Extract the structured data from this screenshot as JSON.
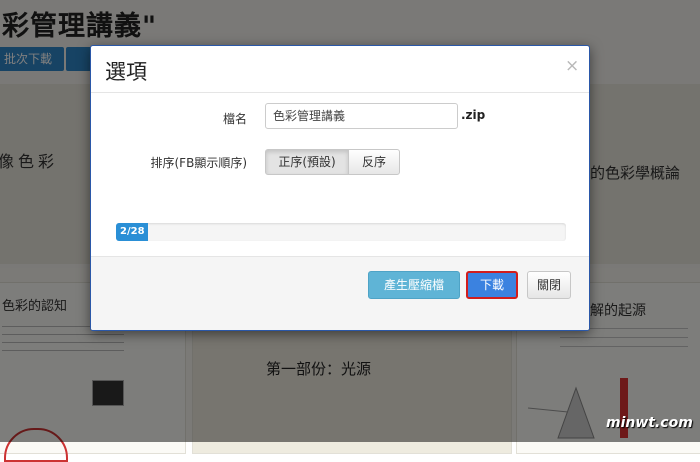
{
  "background": {
    "title": "彩管理講義\"",
    "buttons": [
      "批次下載",
      ""
    ],
    "heading_left": "像色彩",
    "heading_right": "的色彩學概論",
    "section_left": "色彩的認知",
    "section_center": "第一部份：光源",
    "section_right": "解的起源"
  },
  "modal": {
    "title": "選項",
    "close_glyph": "×",
    "filename_label": "檔名",
    "filename_value": "色彩管理講義",
    "zip_suffix": ".zip",
    "sort_label": "排序(FB顯示順序)",
    "sort_options": [
      "正序(預設)",
      "反序"
    ],
    "sort_selected": "正序(預設)",
    "progress": {
      "text": "2/28",
      "current": 2,
      "total": 28
    },
    "buttons": {
      "zip": "產生壓縮檔",
      "download": "下載",
      "close": "關閉"
    }
  },
  "watermark": "minwt.com",
  "colors": {
    "primary": "#3b82e0",
    "info": "#5fb4d6",
    "progress": "#2a8fd6",
    "highlight_border": "#d21d1d"
  }
}
